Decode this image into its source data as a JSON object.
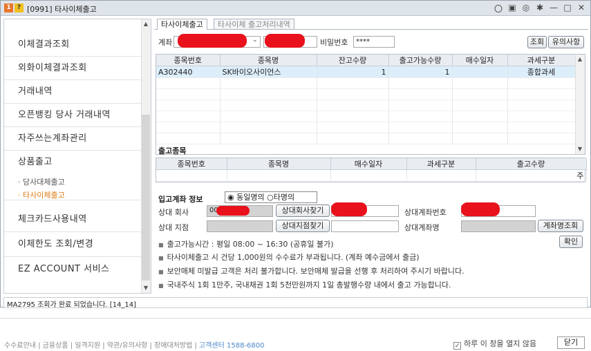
{
  "window": {
    "app_icon": "1",
    "help_icon": "?",
    "title": "[0991] 타사이체출고",
    "controls": [
      "〇",
      "▣",
      "◎",
      "✱",
      "—",
      "□",
      "✕"
    ]
  },
  "sidebar": {
    "items": [
      {
        "label": "이체결과조회"
      },
      {
        "label": "외화이체결과조회"
      },
      {
        "label": "거래내역"
      },
      {
        "label": "오픈뱅킹 당사 거래내역"
      },
      {
        "label": "자주쓰는계좌관리"
      },
      {
        "label": "상품출고"
      },
      {
        "label": "체크카드사용내역"
      },
      {
        "label": "이체한도 조회/변경"
      },
      {
        "label": "EZ ACCOUNT 서비스"
      }
    ],
    "subitems": [
      "· 당사대체출고",
      "· 타사이체출고"
    ]
  },
  "tabs": [
    "타사이체출고",
    "타사이체 출고처리내역"
  ],
  "account": {
    "label": "계좌",
    "password_label": "비밀번호",
    "password_value": "****",
    "search_button": "조회",
    "notice_button": "유의사항"
  },
  "holdings": {
    "columns": [
      "종목번호",
      "종목명",
      "잔고수량",
      "출고가능수량",
      "매수일자",
      "과세구분"
    ],
    "rows": [
      {
        "code": "A302440",
        "name": "SK바이오사이언스",
        "balance": "1",
        "available": "1",
        "buy_date": "",
        "tax": "종합과세"
      }
    ]
  },
  "transfer": {
    "title": "출고종목",
    "columns": [
      "종목번호",
      "종목명",
      "매수일자",
      "과세구분",
      "출고수량"
    ],
    "cut_char": "주"
  },
  "deposit": {
    "title": "입고계좌 정보",
    "radio_same": "동일명의",
    "radio_other": "타명의",
    "company_label": "상대 회사",
    "company_code": "00",
    "find_company_button": "상대회사찾기",
    "account_no_label": "상대계좌번호",
    "branch_label": "상대 지점",
    "find_branch_button": "상대지점찾기",
    "account_name_label": "상대계좌명",
    "account_name_button": "계좌명조회",
    "confirm_button": "확인"
  },
  "notes": [
    "출고가능시간 : 평일 08:00 ~ 16:30 (공휴일 불가)",
    "타사이체출고 시 건당 1,000원의 수수료가 부과됩니다. (계좌 예수금에서 출금)",
    "보안매체 미발급 고객은 처리 불가합니다. 보안매체 발급을 선행 후 처리하여 주시기 바랍니다.",
    "국내주식 1회 1만주, 국내채권 1회 5천만원까지 1일 총발행수량 내에서 출고 가능합니다."
  ],
  "status": "MA2795 조회가 완료 되었습니다. [14_14]",
  "footer": {
    "links": "수수료안내 | 금융상품 | 일격지원 | 약관/유의사항 | 장애대처방법 | ",
    "tel": "고객센터 1588-6800",
    "checkbox_label": "하루 이 창을 열지 않음",
    "close_button": "닫기"
  }
}
